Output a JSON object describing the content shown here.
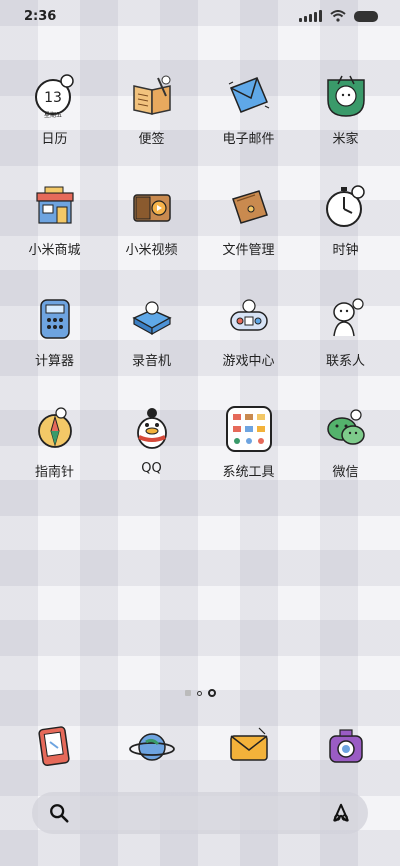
{
  "status": {
    "time": "2:36"
  },
  "calendar": {
    "day": "13",
    "weekday": "星期五"
  },
  "apps": [
    {
      "label": "日历",
      "icon": "calendar-icon"
    },
    {
      "label": "便签",
      "icon": "notes-icon"
    },
    {
      "label": "电子邮件",
      "icon": "email-icon"
    },
    {
      "label": "米家",
      "icon": "mijia-icon"
    },
    {
      "label": "小米商城",
      "icon": "store-icon"
    },
    {
      "label": "小米视频",
      "icon": "video-icon"
    },
    {
      "label": "文件管理",
      "icon": "file-manager-icon"
    },
    {
      "label": "时钟",
      "icon": "clock-icon"
    },
    {
      "label": "计算器",
      "icon": "calculator-icon"
    },
    {
      "label": "录音机",
      "icon": "recorder-icon"
    },
    {
      "label": "游戏中心",
      "icon": "game-center-icon"
    },
    {
      "label": "联系人",
      "icon": "contacts-icon"
    },
    {
      "label": "指南针",
      "icon": "compass-icon"
    },
    {
      "label": "QQ",
      "icon": "qq-icon"
    },
    {
      "label": "系统工具",
      "icon": "system-tools-folder-icon"
    },
    {
      "label": "微信",
      "icon": "wechat-icon"
    }
  ],
  "dock": [
    {
      "icon": "phone-icon"
    },
    {
      "icon": "browser-icon"
    },
    {
      "icon": "messages-icon"
    },
    {
      "icon": "camera-icon"
    }
  ],
  "pager": {
    "pages": 2,
    "active": 2
  }
}
